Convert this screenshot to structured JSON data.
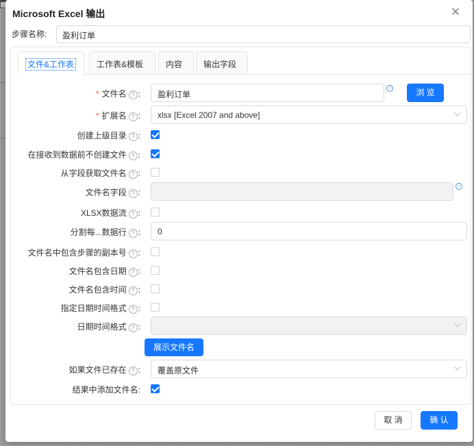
{
  "dialog": {
    "title": "Microsoft Excel 输出",
    "close_glyph": "✕"
  },
  "step": {
    "label": "步骤名称:",
    "value": "盈利订单"
  },
  "tabs": [
    {
      "label": "文件&工作表",
      "active": true
    },
    {
      "label": "工作表&模板",
      "active": false
    },
    {
      "label": "内容",
      "active": false
    },
    {
      "label": "输出字段",
      "active": false
    }
  ],
  "form": {
    "filename": {
      "label": "文件名",
      "value": "盈利订单",
      "required": true
    },
    "browse_label": "浏 览",
    "extension": {
      "label": "扩展名",
      "value": "xlsx [Excel 2007 and above]",
      "required": true
    },
    "create_parent_dir": {
      "label": "创建上级目录",
      "checked": true
    },
    "no_create_until_data": {
      "label": "在接收到数据前不创建文件",
      "checked": true
    },
    "filename_from_field": {
      "label": "从字段获取文件名",
      "checked": false
    },
    "filename_field": {
      "label": "文件名字段",
      "value": ""
    },
    "xlsx_stream": {
      "label": "XLSX数据流",
      "checked": false
    },
    "split_every": {
      "label": "分割每...数据行",
      "value": "0"
    },
    "include_stepnr": {
      "label": "文件名中包含步骤的副本号",
      "checked": false
    },
    "include_date": {
      "label": "文件名包含日期",
      "checked": false
    },
    "include_time": {
      "label": "文件名包含时间",
      "checked": false
    },
    "specify_format": {
      "label": "指定日期时间格式",
      "checked": false
    },
    "date_format": {
      "label": "日期时间格式",
      "value": ""
    },
    "show_filename_label": "展示文件名",
    "if_exists": {
      "label": "如果文件已存在",
      "value": "覆盖原文件"
    },
    "add_to_result": {
      "label": "结果中添加文件名:",
      "checked": true
    }
  },
  "footer": {
    "cancel_label": "取 消",
    "ok_label": "确 认"
  },
  "colors": {
    "accent": "#1677ff",
    "required": "#ff4d4f"
  },
  "icons": {
    "help": "question-circle-icon",
    "info": "info-circle-icon",
    "select": "chevron-down-icon"
  }
}
